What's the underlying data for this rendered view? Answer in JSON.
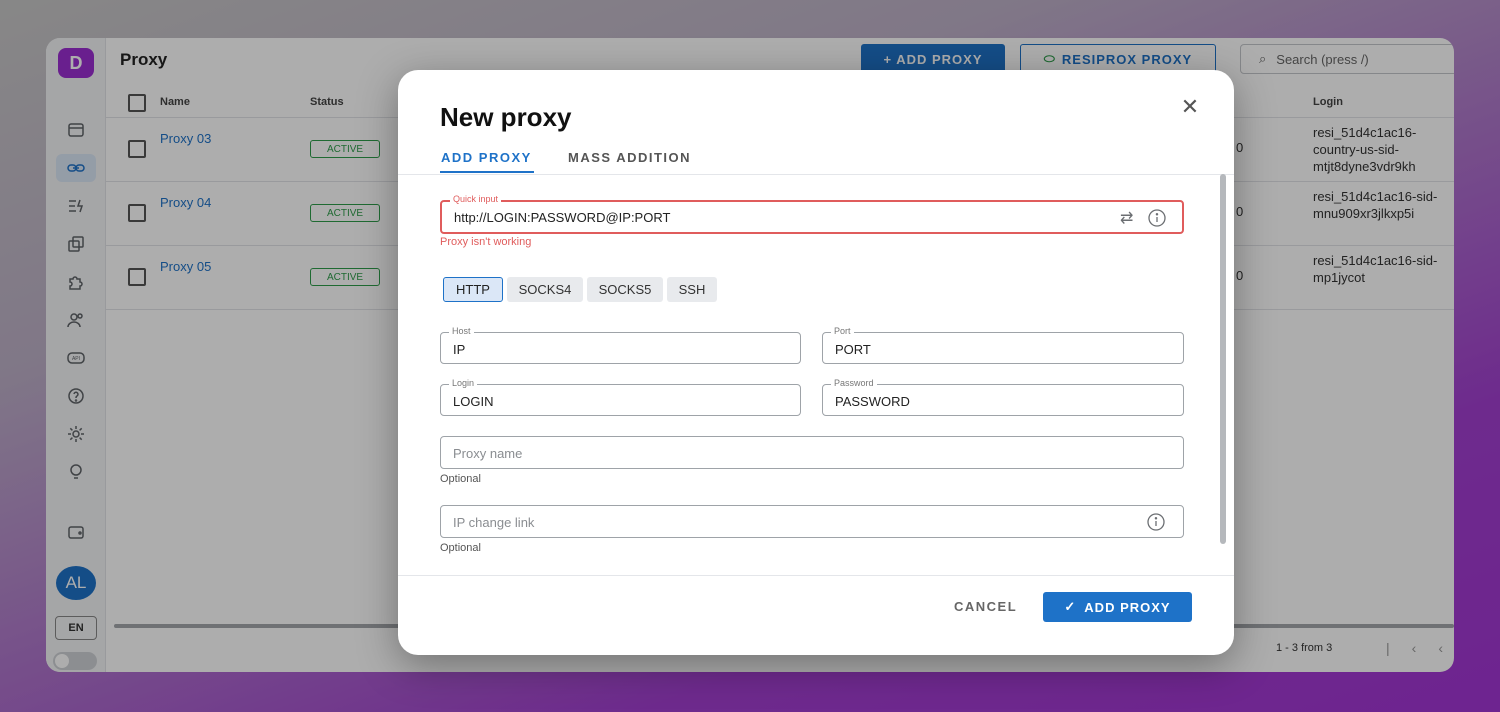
{
  "app": {
    "logo": "D",
    "page_title": "Proxy",
    "add_proxy_button": "+ ADD PROXY",
    "resiprox_button": "RESIPROX PROXY",
    "search_placeholder": "Search (press /)",
    "avatar": "AL",
    "lang": "EN"
  },
  "table": {
    "columns": [
      "Name",
      "Status",
      "Login"
    ],
    "rows": [
      {
        "name": "Proxy 03",
        "status": "ACTIVE",
        "count": "0",
        "login": "resi_51d4c1ac16-country-us-sid-mtjt8dyne3vdr9kh"
      },
      {
        "name": "Proxy 04",
        "status": "ACTIVE",
        "count": "0",
        "login": "resi_51d4c1ac16-sid-mnu909xr3jlkxp5i"
      },
      {
        "name": "Proxy 05",
        "status": "ACTIVE",
        "count": "0",
        "login": "resi_51d4c1ac16-sid-mp1jycot"
      }
    ],
    "pagination": "1 - 3 from 3"
  },
  "modal": {
    "title": "New proxy",
    "tabs": [
      "ADD PROXY",
      "MASS ADDITION"
    ],
    "quick_input": {
      "label": "Quick input",
      "value": "http://LOGIN:PASSWORD@IP:PORT",
      "error": "Proxy isn't working"
    },
    "proxy_types": [
      "HTTP",
      "SOCKS4",
      "SOCKS5",
      "SSH"
    ],
    "selected_type": "HTTP",
    "host": {
      "label": "Host",
      "value": "IP"
    },
    "port": {
      "label": "Port",
      "value": "PORT"
    },
    "login": {
      "label": "Login",
      "value": "LOGIN"
    },
    "password": {
      "label": "Password",
      "value": "PASSWORD"
    },
    "proxy_name": {
      "placeholder": "Proxy name",
      "helper": "Optional"
    },
    "ip_change_link": {
      "placeholder": "IP change link",
      "helper": "Optional"
    },
    "cancel": "CANCEL",
    "submit": "ADD PROXY"
  },
  "colors": {
    "accent": "#1e72c8",
    "error": "#e05c5c",
    "active": "#2e9c4a",
    "brand": "#9b2fd1"
  }
}
